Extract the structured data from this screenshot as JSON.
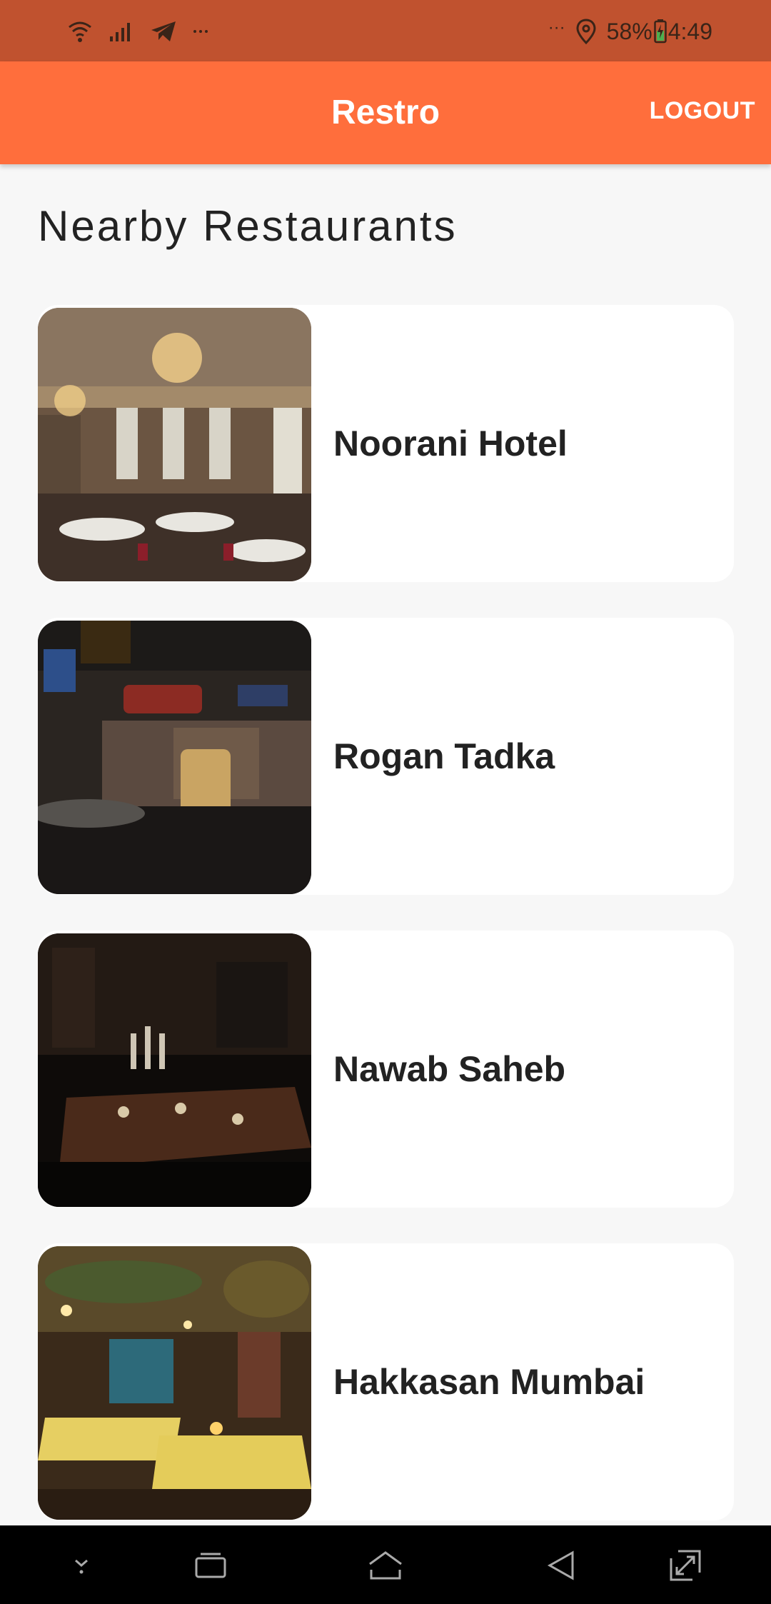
{
  "status_bar": {
    "left_icons": [
      "wifi-icon",
      "signal-icon",
      "telegram-icon",
      "more-icon"
    ],
    "right_more": "···",
    "battery_percent": "58%",
    "time": "4:49",
    "colors": {
      "background": "#c0522f",
      "text": "#3a2418"
    }
  },
  "app_bar": {
    "title": "Restro",
    "logout_label": "LOGOUT",
    "color": "#ff6e3c"
  },
  "section_title": "Nearby Restaurants",
  "restaurants": [
    {
      "name": "Noorani Hotel",
      "image": "ornate-dining-hall-photo"
    },
    {
      "name": "Rogan Tadka",
      "image": "dark-neon-restaurant-photo"
    },
    {
      "name": "Nawab Saheb",
      "image": "dim-candlelit-dining-photo"
    },
    {
      "name": "Hakkasan Mumbai",
      "image": "warm-lit-garden-restaurant-photo"
    }
  ],
  "nav_bar": {
    "buttons": [
      "hide-keyboard-icon",
      "recent-apps-icon",
      "home-icon",
      "back-icon",
      "expand-icon"
    ]
  }
}
